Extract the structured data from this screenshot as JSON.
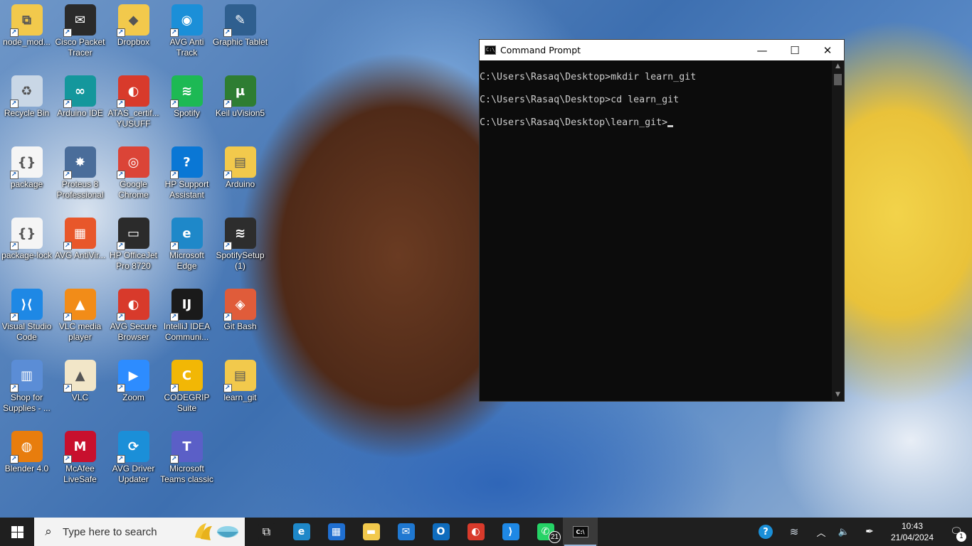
{
  "desktop": {
    "icons": [
      {
        "label": "node_mod...",
        "glyph": "⧉",
        "color": "#f2c94c"
      },
      {
        "label": "Cisco Packet Tracer",
        "glyph": "✉",
        "color": "#2a2a2a"
      },
      {
        "label": "Dropbox",
        "glyph": "◆",
        "color": "#f2c94c"
      },
      {
        "label": "AVG Anti Track",
        "glyph": "◉",
        "color": "#1b8fd8"
      },
      {
        "label": "Graphic Tablet",
        "glyph": "✎",
        "color": "#2f5f8f"
      },
      {
        "label": "Recycle Bin",
        "glyph": "♻",
        "color": "#c9d7e6"
      },
      {
        "label": "Arduino IDE",
        "glyph": "∞",
        "color": "#14979c"
      },
      {
        "label": "ATAS_certif... YUSUFF",
        "glyph": "◐",
        "color": "#d83a2b"
      },
      {
        "label": "Spotify",
        "glyph": "≋",
        "color": "#1db954"
      },
      {
        "label": "Keil uVision5",
        "glyph": "μ",
        "color": "#2e7d32"
      },
      {
        "label": "package",
        "glyph": "{}",
        "color": "#f5f5f5"
      },
      {
        "label": "Proteus 8 Professional",
        "glyph": "✸",
        "color": "#4a6d9a"
      },
      {
        "label": "Google Chrome",
        "glyph": "◎",
        "color": "#db4437"
      },
      {
        "label": "HP Support Assistant",
        "glyph": "?",
        "color": "#0a77d5"
      },
      {
        "label": "Arduino",
        "glyph": "▤",
        "color": "#f2c94c"
      },
      {
        "label": "package-lock",
        "glyph": "{}",
        "color": "#f5f5f5"
      },
      {
        "label": "AVG AntiVir...",
        "glyph": "▦",
        "color": "#e8572a"
      },
      {
        "label": "HP OfficeJet Pro 8720",
        "glyph": "▭",
        "color": "#2b2b2b"
      },
      {
        "label": "Microsoft Edge",
        "glyph": "e",
        "color": "#1e88c9"
      },
      {
        "label": "SpotifySetup (1)",
        "glyph": "≋",
        "color": "#2d2d2d"
      },
      {
        "label": "Visual Studio Code",
        "glyph": "⟩⟨",
        "color": "#1e88e5"
      },
      {
        "label": "VLC media player",
        "glyph": "▲",
        "color": "#f28c18"
      },
      {
        "label": "AVG Secure Browser",
        "glyph": "◐",
        "color": "#d83a2b"
      },
      {
        "label": "IntelliJ IDEA Communi...",
        "glyph": "IJ",
        "color": "#1a1a1a"
      },
      {
        "label": "Git Bash",
        "glyph": "◈",
        "color": "#e05c3a"
      },
      {
        "label": "Shop for Supplies - ...",
        "glyph": "▥",
        "color": "#5b8dd6"
      },
      {
        "label": "VLC",
        "glyph": "▲",
        "color": "#f2e6c8"
      },
      {
        "label": "Zoom",
        "glyph": "▶",
        "color": "#2d8cff"
      },
      {
        "label": "CODEGRIP Suite",
        "glyph": "C",
        "color": "#f2b705"
      },
      {
        "label": "learn_git",
        "glyph": "▤",
        "color": "#f2c94c"
      },
      {
        "label": "Blender 4.0",
        "glyph": "◍",
        "color": "#e87d0d"
      },
      {
        "label": "McAfee LiveSafe",
        "glyph": "M",
        "color": "#c8102e"
      },
      {
        "label": "AVG Driver Updater",
        "glyph": "⟳",
        "color": "#1b8fd8"
      },
      {
        "label": "Microsoft Teams classic",
        "glyph": "T",
        "color": "#5b5fc7"
      }
    ]
  },
  "cmd": {
    "title": "Command Prompt",
    "app_icon": "C:\\_",
    "minimize": "—",
    "maximize": "☐",
    "close": "✕",
    "lines": [
      "C:\\Users\\Rasaq\\Desktop>mkdir learn_git",
      "C:\\Users\\Rasaq\\Desktop>cd learn_git"
    ],
    "prompt": "C:\\Users\\Rasaq\\Desktop\\learn_git>",
    "scroll_up": "▲",
    "scroll_down": "▼"
  },
  "taskbar": {
    "search_placeholder": "Type here to search",
    "search_icon": "⌕",
    "apps": [
      {
        "name": "task-view",
        "glyph": "⧉",
        "color": "#1f1f1f"
      },
      {
        "name": "edge",
        "glyph": "e",
        "color": "#1e88c9"
      },
      {
        "name": "microsoft-store",
        "glyph": "▦",
        "color": "#1f6fd1"
      },
      {
        "name": "file-explorer",
        "glyph": "▬",
        "color": "#f2c94c"
      },
      {
        "name": "mail",
        "glyph": "✉",
        "color": "#1f78d1"
      },
      {
        "name": "outlook",
        "glyph": "O",
        "color": "#0f6cbd"
      },
      {
        "name": "avg-browser",
        "glyph": "◐",
        "color": "#d83a2b"
      },
      {
        "name": "vscode",
        "glyph": "⟩",
        "color": "#1e88e5"
      },
      {
        "name": "whatsapp",
        "glyph": "✆",
        "color": "#25d366",
        "badge": "21"
      },
      {
        "name": "command-prompt",
        "glyph": "C:\\",
        "color": "#0c0c0c",
        "active": true
      }
    ],
    "tray": {
      "help": "?",
      "weather": "≋",
      "chevron": "︿",
      "volume": "🔈",
      "pen": "✒",
      "time": "10:43",
      "date": "21/04/2024",
      "notifications": "🗨",
      "notification_count": "1"
    }
  }
}
